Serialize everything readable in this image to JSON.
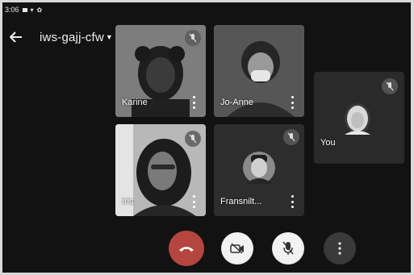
{
  "status_bar": {
    "time": "3:06"
  },
  "header": {
    "meeting_code": "iws-gajj-cfw"
  },
  "participants": [
    {
      "name": "Karine",
      "muted": true
    },
    {
      "name": "Jo-Anne"
    },
    {
      "name": "Iris",
      "muted": true
    },
    {
      "name": "Fransnilt...",
      "muted": true
    },
    {
      "name": "You",
      "muted": true
    }
  ],
  "colors": {
    "background": "#121212",
    "end_call": "#b5453f",
    "control_light": "#f2f2f2",
    "control_dark": "#3a3a3a",
    "tile_dark": "#2d2d2d"
  },
  "icons": {
    "back": "arrow-left-icon",
    "end_call": "hangup-icon",
    "camera_off": "camera-off-icon",
    "mic_off": "mic-off-icon",
    "more": "more-vertical-icon",
    "caret": "caret-down-icon"
  }
}
